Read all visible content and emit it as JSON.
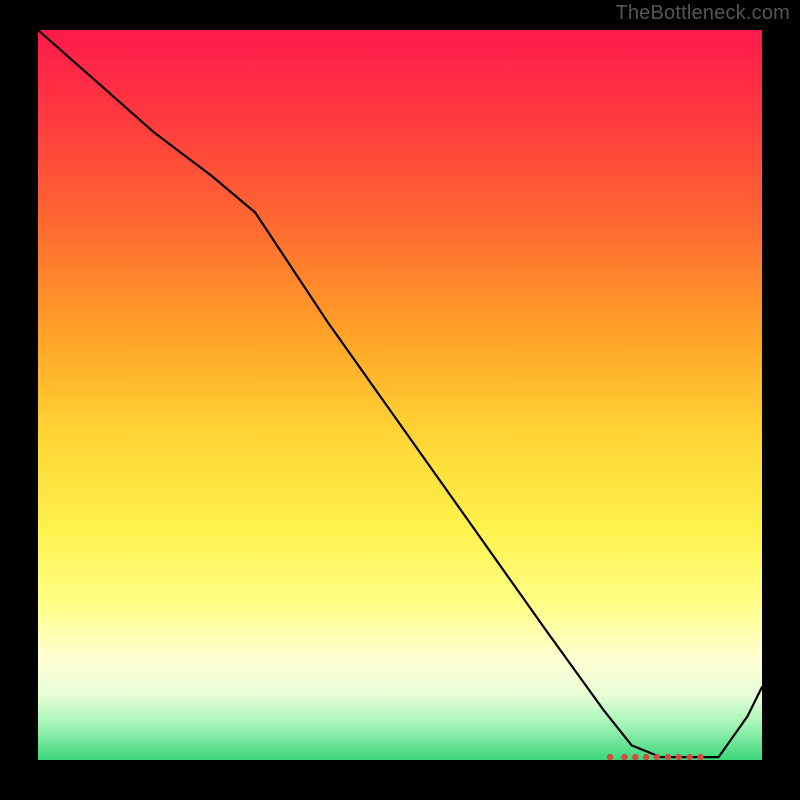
{
  "watermark": "TheBottleneck.com",
  "chart_data": {
    "type": "line",
    "title": "",
    "xlabel": "",
    "ylabel": "",
    "xlim": [
      0,
      100
    ],
    "ylim": [
      0,
      100
    ],
    "series": [
      {
        "name": "curve",
        "x": [
          0,
          8,
          16,
          24,
          30,
          40,
          50,
          60,
          70,
          78,
          82,
          86,
          90,
          94,
          98,
          100
        ],
        "values": [
          100,
          93,
          86,
          80,
          75,
          60,
          46,
          32,
          18,
          7,
          2,
          0.4,
          0.4,
          0.4,
          6,
          10
        ]
      }
    ],
    "markers": {
      "name": "bottom-dots",
      "x": [
        79,
        81,
        82.5,
        84,
        85.5,
        87,
        88.5,
        90,
        91.5
      ],
      "y_value": 0.4,
      "color": "#d84a3f"
    },
    "colors": {
      "curve": "#000000",
      "gradient_top": "#ff1a4b",
      "gradient_bottom": "#3bd67a",
      "marker": "#d84a3f"
    }
  }
}
